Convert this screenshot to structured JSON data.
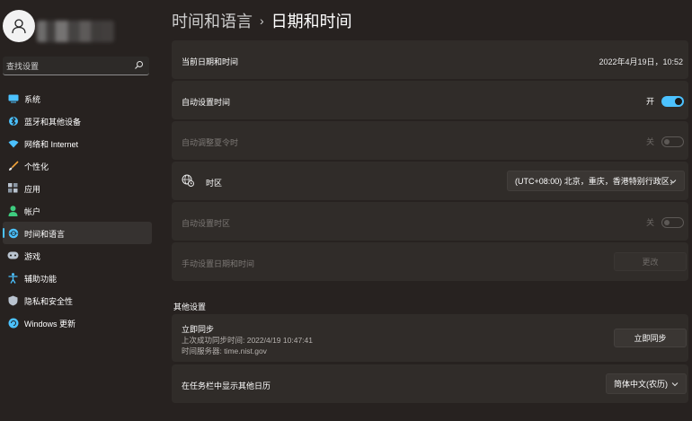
{
  "sidebar": {
    "search_placeholder": "查找设置",
    "items": [
      {
        "label": "系统",
        "icon": "system-icon",
        "color": "#4cc2ff"
      },
      {
        "label": "蓝牙和其他设备",
        "icon": "bluetooth-icon",
        "color": "#4cc2ff"
      },
      {
        "label": "网络和 Internet",
        "icon": "wifi-icon",
        "color": "#4cc2ff"
      },
      {
        "label": "个性化",
        "icon": "brush-icon",
        "color": "#f2a33a"
      },
      {
        "label": "应用",
        "icon": "apps-icon",
        "color": "#b9c3cf"
      },
      {
        "label": "帐户",
        "icon": "account-icon",
        "color": "#3ecc7f"
      },
      {
        "label": "时间和语言",
        "icon": "globe-clock-icon",
        "color": "#4cc2ff",
        "active": true
      },
      {
        "label": "游戏",
        "icon": "gamepad-icon",
        "color": "#b9c3cf"
      },
      {
        "label": "辅助功能",
        "icon": "accessibility-icon",
        "color": "#4cc2ff"
      },
      {
        "label": "隐私和安全性",
        "icon": "shield-icon",
        "color": "#b9c3cf"
      },
      {
        "label": "Windows 更新",
        "icon": "update-icon",
        "color": "#4cc2ff"
      }
    ]
  },
  "header": {
    "parent": "时间和语言",
    "separator": "›",
    "current": "日期和时间"
  },
  "settings": {
    "current_datetime_label": "当前日期和时间",
    "current_datetime_value": "2022年4月19日，10:52",
    "auto_time_label": "自动设置时间",
    "auto_time_state": "开",
    "auto_dst_label": "自动调整夏令时",
    "auto_dst_state": "关",
    "timezone_label": "时区",
    "timezone_value": "(UTC+08:00) 北京，重庆，香港特别行政区，",
    "auto_timezone_label": "自动设置时区",
    "auto_timezone_state": "关",
    "manual_label": "手动设置日期和时间",
    "manual_button": "更改"
  },
  "other": {
    "section_title": "其他设置",
    "sync_title": "立即同步",
    "sync_last": "上次成功同步时间: 2022/4/19 10:47:41",
    "sync_server": "时间服务器: time.nist.gov",
    "sync_button": "立即同步",
    "calendar_label": "在任务栏中显示其他日历",
    "calendar_value": "简体中文(农历)"
  },
  "colors": {
    "accent": "#4cc2ff",
    "background": "#272220",
    "card": "#302c29"
  }
}
